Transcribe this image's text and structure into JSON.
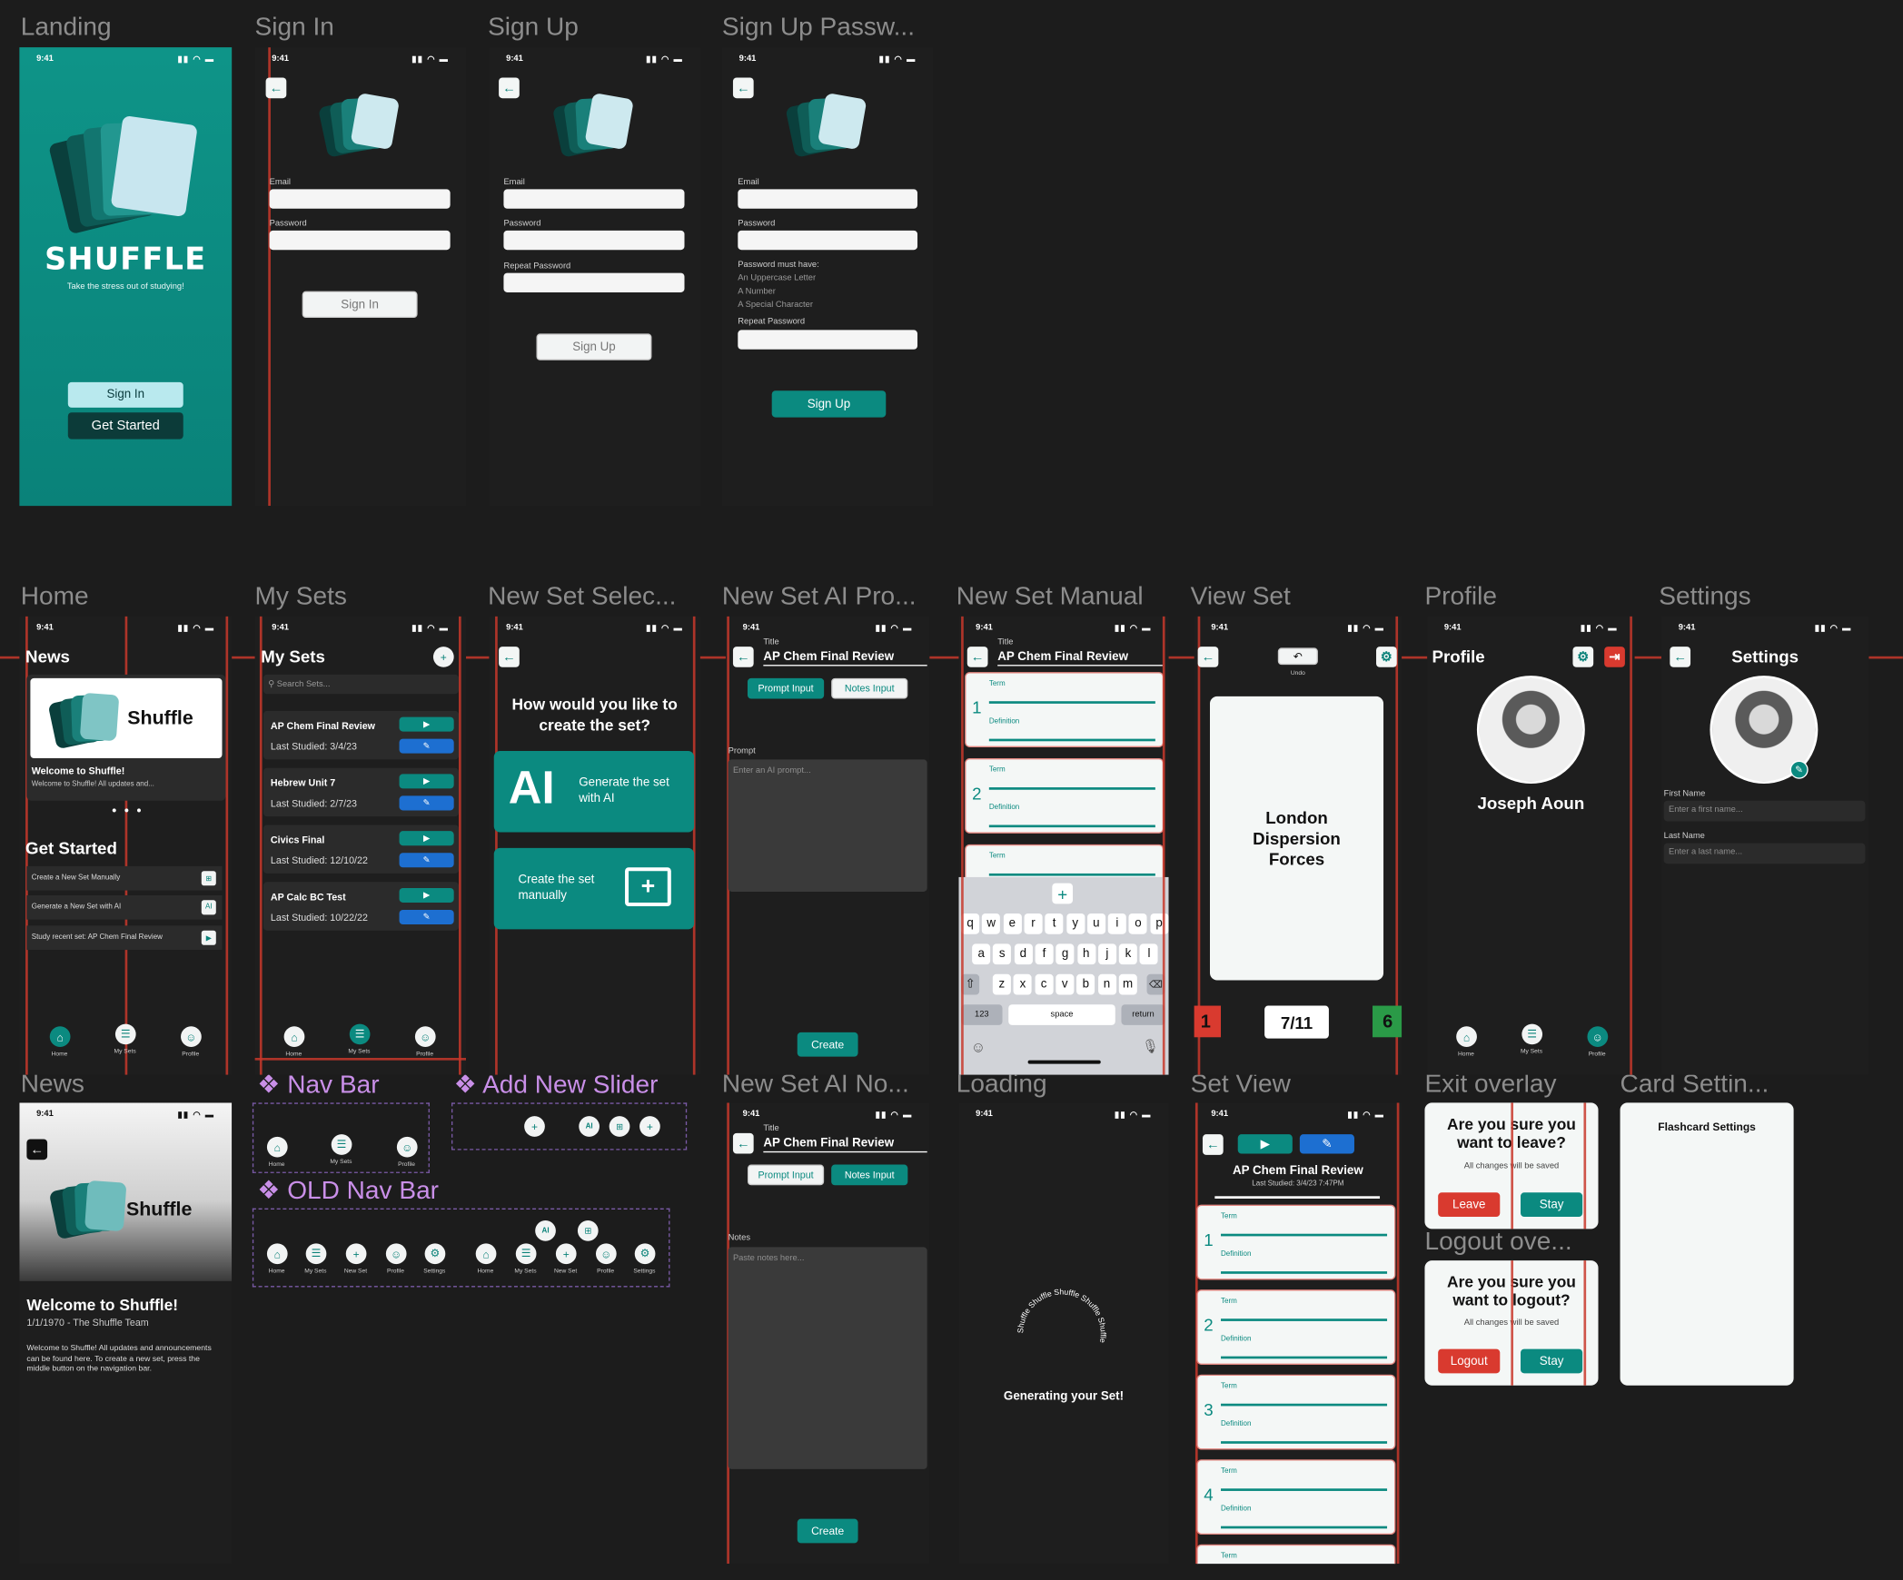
{
  "frames": {
    "landing": "Landing",
    "signin": "Sign In",
    "signup": "Sign Up",
    "signup_pw": "Sign Up Passw...",
    "home": "Home",
    "mysets": "My Sets",
    "newset_select": "New Set Selec...",
    "newset_ai_prompt": "New Set AI Pro...",
    "newset_manual": "New Set Manual",
    "view_set": "View Set",
    "profile": "Profile",
    "settings": "Settings",
    "news": "News",
    "navbar": "Nav Bar",
    "add_new_slider": "Add New Slider",
    "old_navbar": "OLD Nav Bar",
    "newset_ai_notes": "New Set AI No...",
    "loading": "Loading",
    "set_view": "Set View",
    "exit_overlay": "Exit overlay",
    "logout_overlay": "Logout ove...",
    "card_settings": "Card Settin..."
  },
  "status_time": "9:41",
  "landing": {
    "app_name": "SHUFFLE",
    "tagline": "Take the stress out of studying!",
    "signin": "Sign In",
    "get_started": "Get Started"
  },
  "auth": {
    "email": "Email",
    "password": "Password",
    "repeat_password": "Repeat Password",
    "signin": "Sign In",
    "signup": "Sign Up",
    "pw_rules_title": "Password must have:",
    "pw_rules": [
      "An Uppercase Letter",
      "A Number",
      "A Special Character"
    ]
  },
  "home": {
    "news_title": "News",
    "news_logo": "Shuffle",
    "news_heading": "Welcome to Shuffle!",
    "news_preview": "Welcome to Shuffle! All updates and...",
    "get_started_title": "Get Started",
    "items": [
      "Create a New Set Manually",
      "Generate a New Set with AI",
      "Study recent set: AP Chem Final Review"
    ],
    "item_icons": [
      "plus-card-icon",
      "ai-icon",
      "play-icon"
    ]
  },
  "nav": {
    "home": "Home",
    "mysets": "My Sets",
    "profile": "Profile",
    "newset": "New Set",
    "settings": "Settings"
  },
  "mysets": {
    "title": "My Sets",
    "search_placeholder": "Search Sets...",
    "sets": [
      {
        "name": "AP Chem Final Review",
        "date": "Last Studied: 3/4/23"
      },
      {
        "name": "Hebrew Unit 7",
        "date": "Last Studied: 2/7/23"
      },
      {
        "name": "Civics Final",
        "date": "Last Studied: 12/10/22"
      },
      {
        "name": "AP Calc BC Test",
        "date": "Last Studied: 10/22/22"
      }
    ]
  },
  "newset_select": {
    "question": "How would you like to create the set?",
    "ai_big": "AI",
    "ai_label": "Generate the set with AI",
    "manual_label": "Create the set manually"
  },
  "ai": {
    "title_label": "Title",
    "title_value": "AP Chem Final Review",
    "prompt_tab": "Prompt Input",
    "notes_tab": "Notes Input",
    "prompt_label": "Prompt",
    "prompt_placeholder": "Enter an AI prompt...",
    "notes_label": "Notes",
    "notes_placeholder": "Paste notes here...",
    "create": "Create"
  },
  "manual": {
    "term": "Term",
    "definition": "Definition",
    "numbers": [
      "1",
      "2"
    ],
    "keyboard_row1": [
      "q",
      "w",
      "e",
      "r",
      "t",
      "y",
      "u",
      "i",
      "o",
      "p"
    ],
    "keyboard_row2": [
      "a",
      "s",
      "d",
      "f",
      "g",
      "h",
      "j",
      "k",
      "l"
    ],
    "keyboard_row3": [
      "z",
      "x",
      "c",
      "v",
      "b",
      "n",
      "m"
    ],
    "key_123": "123",
    "key_space": "space",
    "key_return": "return"
  },
  "viewset": {
    "undo": "Undo",
    "card_text": "London Dispersion Forces",
    "wrong": "1",
    "progress": "7/11",
    "right": "6"
  },
  "profile": {
    "title": "Profile",
    "name": "Joseph Aoun"
  },
  "settings": {
    "title": "Settings",
    "first_label": "First Name",
    "first_placeholder": "Enter a first name...",
    "last_label": "Last Name",
    "last_placeholder": "Enter a last name..."
  },
  "news": {
    "logo": "Shuffle",
    "heading": "Welcome to Shuffle!",
    "byline": "1/1/1970 - The Shuffle Team",
    "body": "Welcome to Shuffle! All updates and announcements can be found here. To create a new set, press the middle button on the navigation bar."
  },
  "loading": {
    "ring_text": "Shuffle Shuffle Shuffle Shuffle Shuffle",
    "message": "Generating your Set!"
  },
  "setview": {
    "title": "AP Chem Final Review",
    "subtitle": "Last Studied: 3/4/23 7:47PM",
    "numbers": [
      "1",
      "2",
      "3",
      "4"
    ]
  },
  "exit": {
    "question": "Are you sure you want to leave?",
    "note": "All changes will be saved",
    "leave": "Leave",
    "stay": "Stay"
  },
  "logout": {
    "question": "Are you sure you want to logout?",
    "note": "All changes will be saved",
    "logout": "Logout",
    "stay": "Stay"
  },
  "card_settings": {
    "title": "Flashcard Settings"
  },
  "colors": {
    "teal": "#0b8a80",
    "dark_bg": "#1e1e1e",
    "blue": "#1d6fd1",
    "red": "#d93a2f",
    "green": "#2a9a47"
  }
}
